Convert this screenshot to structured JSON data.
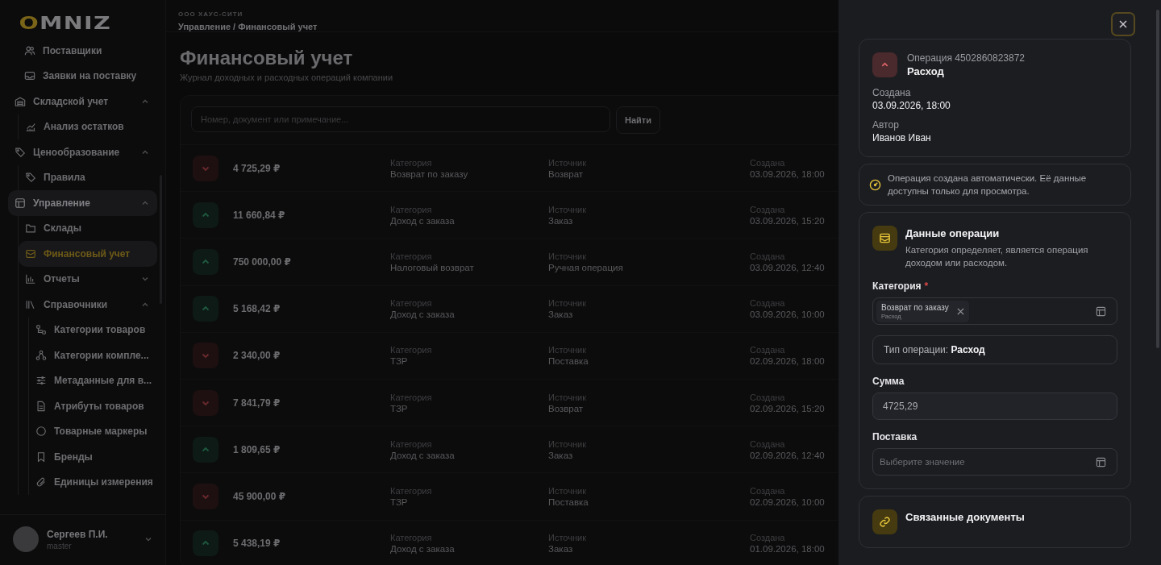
{
  "sidebar": {
    "logo": "OMNIZ",
    "items": [
      {
        "kind": "item",
        "label": "Поставщики",
        "selected": false
      },
      {
        "kind": "item",
        "label": "Заявки на поставку",
        "selected": false
      },
      {
        "kind": "group",
        "label": "Складской учет",
        "expanded": true,
        "selected": false,
        "children": [
          {
            "kind": "item",
            "label": "Анализ остатков",
            "selected": false
          }
        ]
      },
      {
        "kind": "group",
        "label": "Ценообразование",
        "expanded": true,
        "selected": false,
        "children": [
          {
            "kind": "item",
            "label": "Правила",
            "selected": false
          }
        ]
      },
      {
        "kind": "group",
        "label": "Управление",
        "expanded": true,
        "selected": true,
        "children": [
          {
            "kind": "item",
            "label": "Склады",
            "selected": false
          },
          {
            "kind": "item",
            "label": "Финансовый учет",
            "selected": true
          },
          {
            "kind": "group",
            "label": "Отчеты",
            "expanded": false,
            "selected": false
          },
          {
            "kind": "group",
            "label": "Справочники",
            "expanded": true,
            "selected": false,
            "children": [
              {
                "kind": "item",
                "label": "Категории товаров",
                "selected": false
              },
              {
                "kind": "item",
                "label": "Категории компле...",
                "selected": false
              },
              {
                "kind": "item",
                "label": "Метаданные для в...",
                "selected": false
              },
              {
                "kind": "item",
                "label": "Атрибуты товаров",
                "selected": false
              },
              {
                "kind": "item",
                "label": "Товарные маркеры",
                "selected": false
              },
              {
                "kind": "item",
                "label": "Бренды",
                "selected": false
              },
              {
                "kind": "item",
                "label": "Единицы измерения",
                "selected": false
              }
            ]
          }
        ]
      }
    ],
    "user": {
      "name": "Сергеев П.И.",
      "role": "master"
    }
  },
  "header": {
    "company": "ООО ХАУС-СИТИ",
    "breadcrumb": "Управление / Финансовый учет"
  },
  "page": {
    "title": "Финансовый учет",
    "subtitle": "Журнал доходных и расходных операций компании"
  },
  "search": {
    "placeholder": "Номер, документ или примечание...",
    "button": "Найти"
  },
  "operations": [
    {
      "kind": "expense",
      "amount": "4 725,29 ₽",
      "category_label": "Категория",
      "category": "Возврат по заказу",
      "source_label": "Источник",
      "source": "Возврат",
      "created_label": "Создана",
      "created": "03.09.2026, 18:00"
    },
    {
      "kind": "income",
      "amount": "11 660,84 ₽",
      "category_label": "Категория",
      "category": "Доход с заказа",
      "source_label": "Источник",
      "source": "Заказ",
      "created_label": "Создана",
      "created": "03.09.2026, 15:20"
    },
    {
      "kind": "income",
      "amount": "750 000,00 ₽",
      "category_label": "Категория",
      "category": "Налоговый возврат",
      "source_label": "Источник",
      "source": "Ручная операция",
      "created_label": "Создана",
      "created": "03.09.2026, 12:40"
    },
    {
      "kind": "income",
      "amount": "5 168,42 ₽",
      "category_label": "Категория",
      "category": "Доход с заказа",
      "source_label": "Источник",
      "source": "Заказ",
      "created_label": "Создана",
      "created": "03.09.2026, 10:00"
    },
    {
      "kind": "expense",
      "amount": "2 340,00 ₽",
      "category_label": "Категория",
      "category": "ТЗР",
      "source_label": "Источник",
      "source": "Поставка",
      "created_label": "Создана",
      "created": "02.09.2026, 18:00"
    },
    {
      "kind": "expense",
      "amount": "7 841,79 ₽",
      "category_label": "Категория",
      "category": "ТЗР",
      "source_label": "Источник",
      "source": "Возврат",
      "created_label": "Создана",
      "created": "02.09.2026, 15:20"
    },
    {
      "kind": "income",
      "amount": "1 809,65 ₽",
      "category_label": "Категория",
      "category": "Доход с заказа",
      "source_label": "Источник",
      "source": "Заказ",
      "created_label": "Создана",
      "created": "02.09.2026, 12:40"
    },
    {
      "kind": "expense",
      "amount": "45 900,00 ₽",
      "category_label": "Категория",
      "category": "ТЗР",
      "source_label": "Источник",
      "source": "Поставка",
      "created_label": "Создана",
      "created": "02.09.2026, 10:00"
    },
    {
      "kind": "income",
      "amount": "5 438,19 ₽",
      "category_label": "Категория",
      "category": "Доход с заказа",
      "source_label": "Источник",
      "source": "Заказ",
      "created_label": "Создана",
      "created": "01.09.2026, 18:00"
    }
  ],
  "drawer": {
    "operation": {
      "kind": "expense",
      "number": "Операция 4502860823872",
      "type": "Расход",
      "fields": [
        {
          "label": "Создана",
          "value": "03.09.2026, 18:00"
        },
        {
          "label": "Автор",
          "value": "Иванов Иван"
        }
      ]
    },
    "notice": "Операция создана автоматически. Её данные доступны только для просмотра.",
    "data_section": {
      "title": "Данные операции",
      "description": "Категория определяет, является операция доходом или расходом.",
      "category": {
        "label": "Категория",
        "required_mark": "*",
        "chip_title": "Возврат по заказу",
        "chip_subtitle": "Расход"
      },
      "type_info": "Тип операции: **Расход**",
      "amount": {
        "label": "Сумма",
        "value": "4725,29"
      },
      "supply": {
        "label": "Поставка",
        "placeholder": "Выберите значение"
      }
    },
    "linked": {
      "title": "Связанные документы"
    }
  }
}
